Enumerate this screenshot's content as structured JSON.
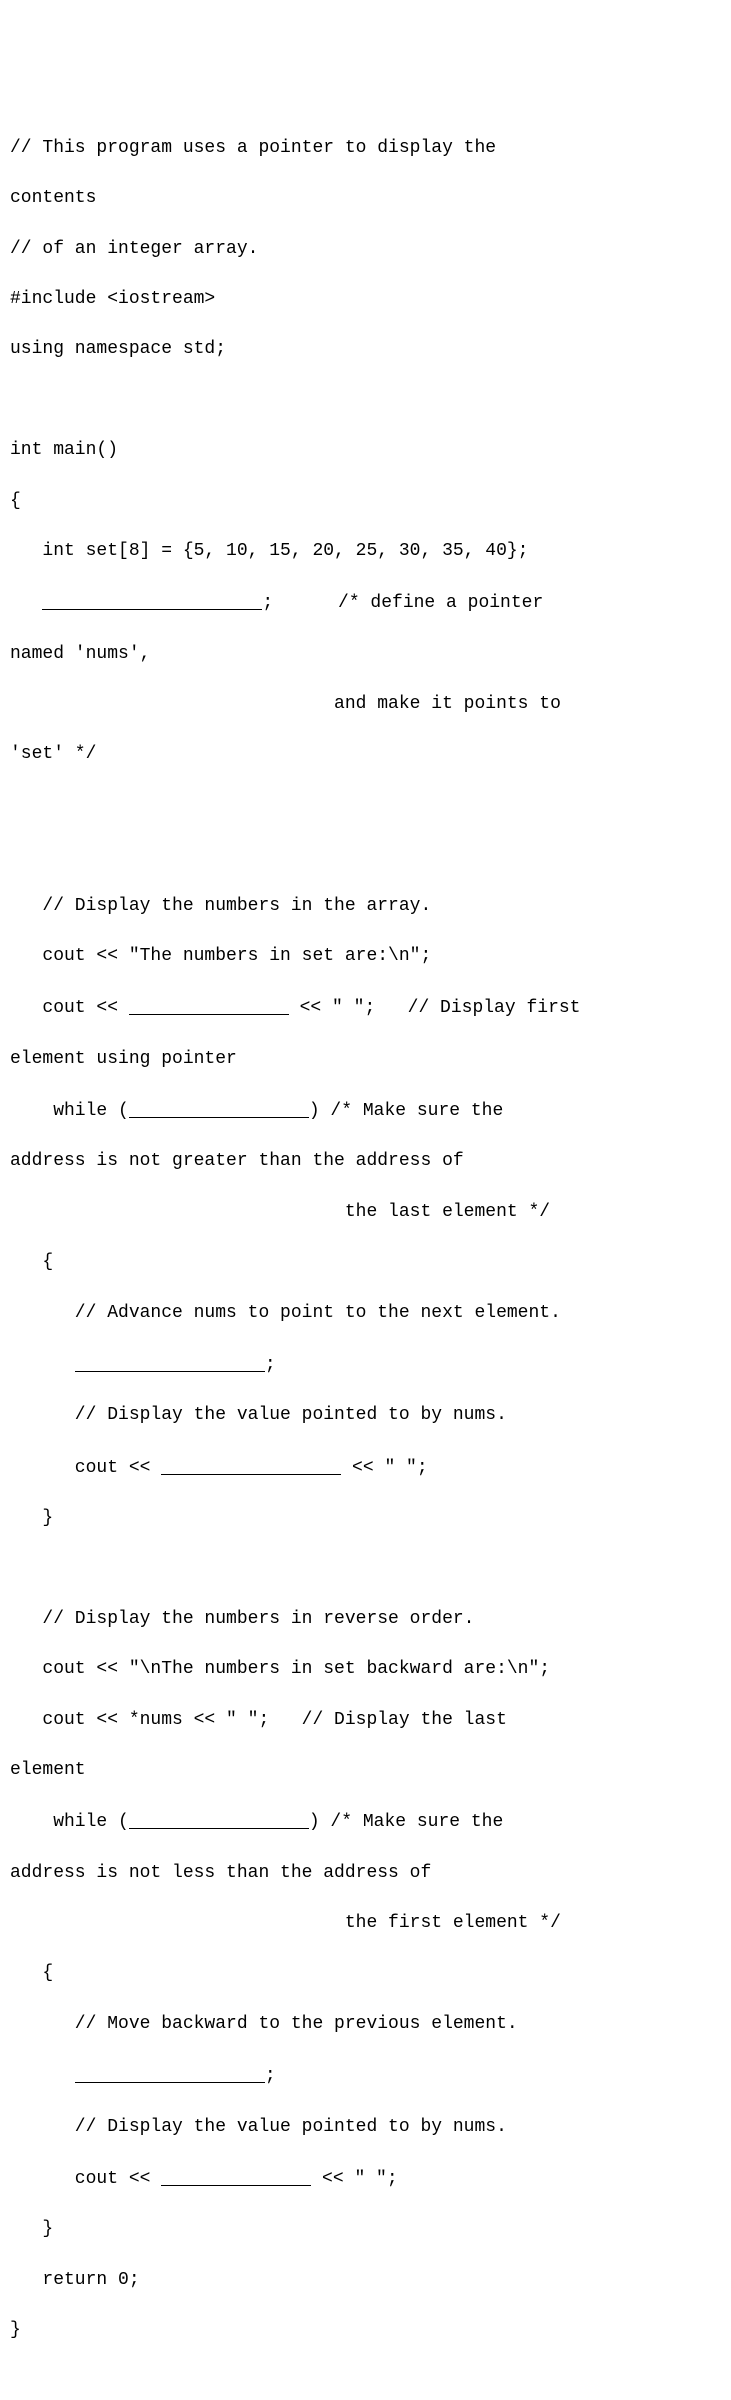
{
  "code": {
    "l1": "// This program uses a pointer to display the",
    "l2": "contents",
    "l3": "// of an integer array.",
    "l4": "#include <iostream>",
    "l5": "using namespace std;",
    "l6": "",
    "l7": "int main()",
    "l8": "{",
    "l9": "   int set[8] = {5, 10, 15, 20, 25, 30, 35, 40};",
    "l10a": "   ",
    "l10b": ";      /* define a pointer",
    "l11": "named 'nums',",
    "l12": "                              and make it points to",
    "l13": "'set' */",
    "l14": "",
    "l15": "",
    "l16": "   // Display the numbers in the array.",
    "l17": "   cout << \"The numbers in set are:\\n\";",
    "l18a": "   cout << ",
    "l18b": " << \" \";   // Display first",
    "l19": "element using pointer",
    "l20a": "    while (",
    "l20b": ") /* Make sure the",
    "l21": "address is not greater than the address of",
    "l22": "                               the last element */",
    "l23": "   {",
    "l24": "      // Advance nums to point to the next element.",
    "l25a": "      ",
    "l25b": ";",
    "l26": "      // Display the value pointed to by nums.",
    "l27a": "      cout << ",
    "l27b": " << \" \";",
    "l28": "   }",
    "l29": "",
    "l30": "   // Display the numbers in reverse order.",
    "l31": "   cout << \"\\nThe numbers in set backward are:\\n\";",
    "l32": "   cout << *nums << \" \";   // Display the last",
    "l33": "element",
    "l34a": "    while (",
    "l34b": ") /* Make sure the",
    "l35": "address is not less than the address of",
    "l36": "                               the first element */",
    "l37": "   {",
    "l38": "      // Move backward to the previous element.",
    "l39a": "      ",
    "l39b": ";",
    "l40": "      // Display the value pointed to by nums.",
    "l41a": "      cout << ",
    "l41b": " << \" \";",
    "l42": "   }",
    "l43": "   return 0;",
    "l44": "}"
  }
}
